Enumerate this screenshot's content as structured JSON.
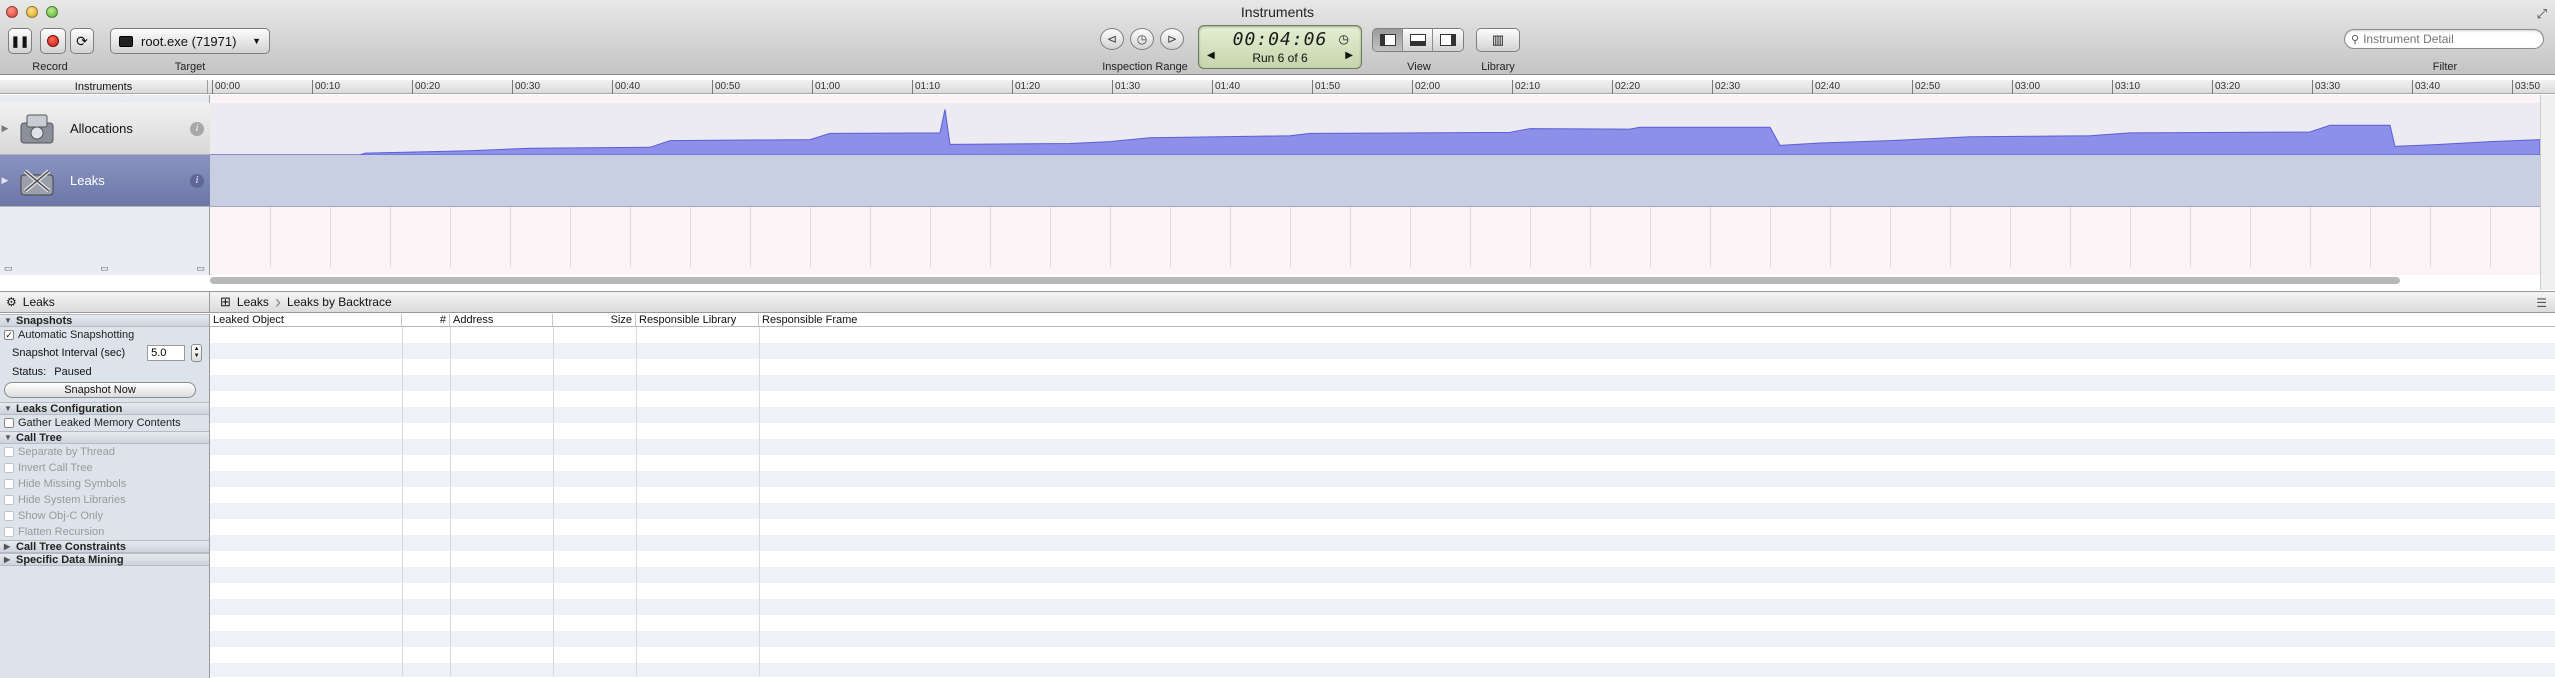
{
  "window": {
    "title": "Instruments"
  },
  "toolbar": {
    "record_label": "Record",
    "target_label": "Target",
    "target_value": "root.exe (71971)",
    "inspection_range_label": "Inspection Range",
    "lcd_time": "00:04:06",
    "lcd_run": "Run 6 of 6",
    "view_label": "View",
    "library_label": "Library",
    "filter_placeholder": "Instrument Detail",
    "filter_label": "Filter"
  },
  "ruler": {
    "header": "Instruments",
    "ticks": [
      "00:00",
      "00:10",
      "00:20",
      "00:30",
      "00:40",
      "00:50",
      "01:00",
      "01:10",
      "01:20",
      "01:30",
      "01:40",
      "01:50",
      "02:00",
      "02:10",
      "02:20",
      "02:30",
      "02:40",
      "02:50",
      "03:00",
      "03:10",
      "03:20",
      "03:30",
      "03:40",
      "03:50"
    ]
  },
  "instruments": [
    {
      "name": "Allocations"
    },
    {
      "name": "Leaks"
    }
  ],
  "allocation_track": {
    "max": 100,
    "series": [
      [
        0,
        0
      ],
      [
        150,
        0
      ],
      [
        155,
        4
      ],
      [
        200,
        6
      ],
      [
        260,
        9
      ],
      [
        320,
        14
      ],
      [
        440,
        16
      ],
      [
        460,
        30
      ],
      [
        600,
        32
      ],
      [
        620,
        45
      ],
      [
        730,
        46
      ],
      [
        735,
        95
      ],
      [
        740,
        22
      ],
      [
        860,
        24
      ],
      [
        900,
        28
      ],
      [
        940,
        36
      ],
      [
        1080,
        40
      ],
      [
        1100,
        45
      ],
      [
        1300,
        47
      ],
      [
        1320,
        55
      ],
      [
        1420,
        54
      ],
      [
        1430,
        58
      ],
      [
        1560,
        58
      ],
      [
        1570,
        20
      ],
      [
        1610,
        25
      ],
      [
        1680,
        30
      ],
      [
        1760,
        38
      ],
      [
        1880,
        40
      ],
      [
        1920,
        46
      ],
      [
        2100,
        48
      ],
      [
        2120,
        62
      ],
      [
        2180,
        62
      ],
      [
        2185,
        18
      ],
      [
        2230,
        22
      ],
      [
        2280,
        28
      ],
      [
        2330,
        32
      ]
    ]
  },
  "nav": {
    "left_label": "Leaks",
    "crumb_root": "Leaks",
    "crumb_current": "Leaks by Backtrace"
  },
  "sidebar": {
    "snapshots_header": "Snapshots",
    "automatic_snapshotting": "Automatic Snapshotting",
    "snapshot_interval_label": "Snapshot Interval (sec)",
    "snapshot_interval_value": "5.0",
    "status_label": "Status:",
    "status_value": "Paused",
    "snapshot_now": "Snapshot Now",
    "leaks_config_header": "Leaks Configuration",
    "gather_leaked": "Gather Leaked Memory Contents",
    "call_tree_header": "Call Tree",
    "call_tree_options": [
      "Separate by Thread",
      "Invert Call Tree",
      "Hide Missing Symbols",
      "Hide System Libraries",
      "Show Obj-C Only",
      "Flatten Recursion"
    ],
    "call_tree_constraints_header": "Call Tree Constraints",
    "specific_data_mining_header": "Specific Data Mining"
  },
  "table": {
    "columns": [
      {
        "label": "Leaked Object",
        "align": "left"
      },
      {
        "label": "#",
        "align": "right"
      },
      {
        "label": "Address",
        "align": "left"
      },
      {
        "label": "Size",
        "align": "right"
      },
      {
        "label": "Responsible Library",
        "align": "left"
      },
      {
        "label": "Responsible Frame",
        "align": "left"
      }
    ]
  },
  "colors": {
    "allocation_fill": "#8d8fe8",
    "allocation_stroke": "#5b5fd6",
    "selected_instrument": "#7a83b5"
  }
}
